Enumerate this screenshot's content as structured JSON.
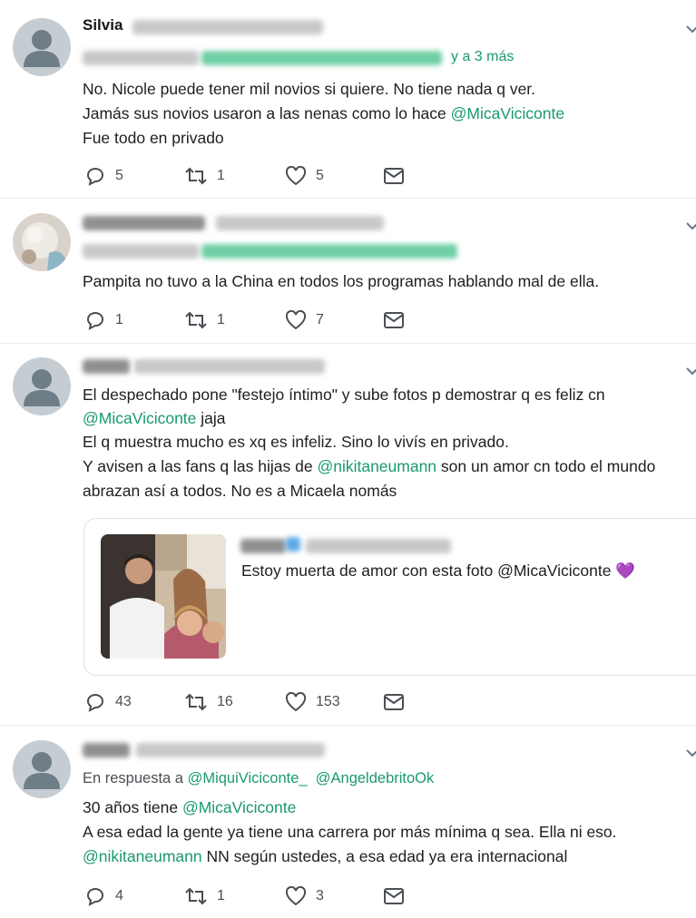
{
  "tweets": [
    {
      "name": "Silvia",
      "handle": "@Silvia20142019",
      "reply_suffix": "y a 3 más",
      "lines": [
        "No. Nicole puede tener mil novios si quiere. No tiene nada q ver.",
        "Jamás sus novios usaron a las nenas como lo hace ",
        "Fue todo en privado"
      ],
      "line2_mention": "@MicaViciconte",
      "stats": {
        "replies": "5",
        "retweets": "1",
        "likes": "5"
      }
    },
    {
      "lines": [
        "Pampita no tuvo a la China en todos los programas hablando mal de ella."
      ],
      "stats": {
        "replies": "1",
        "retweets": "1",
        "likes": "7"
      }
    },
    {
      "line1": "El despechado pone \"festejo íntimo\" y sube fotos p demostrar q es feliz cn",
      "line2_mention": "@MicaViciconte",
      "line2_rest": " jaja",
      "line3": "El q muestra mucho es xq es infeliz. Sino lo vivís en privado.",
      "line4_pre": "Y avisen a las fans q las hijas de ",
      "line4_mention": "@nikitaneumann",
      "line4_rest": " son un amor cn todo el mundo",
      "line5": "abrazan así a todos. No es a Micaela nomás",
      "quote": {
        "text": "Estoy muerta de amor con esta foto @MicaViciconte",
        "emoji": "💜"
      },
      "stats": {
        "replies": "43",
        "retweets": "16",
        "likes": "153"
      }
    },
    {
      "reply_prefix": "En respuesta a ",
      "reply_to_1": "@MiquiViciconte_",
      "reply_to_2": "@AngeldebritoOk",
      "line1_pre": "30 años tiene ",
      "line1_mention": "@MicaViciconte",
      "line2": "A esa edad la gente ya tiene una carrera por más mínima q sea. Ella ni eso.",
      "line3_mention": "@nikitaneumann",
      "line3_rest": " NN según ustedes, a esa edad ya era internacional",
      "stats": {
        "replies": "4",
        "retweets": "1",
        "likes": "3"
      }
    }
  ],
  "icons": {
    "reply": "reply-icon",
    "retweet": "retweet-icon",
    "like": "heart-icon",
    "message": "envelope-icon",
    "menu": "chevron-down-icon"
  },
  "colors": {
    "mention": "#1a9a6c",
    "icon": "#4a4f54",
    "divider": "#e6ecf0"
  }
}
